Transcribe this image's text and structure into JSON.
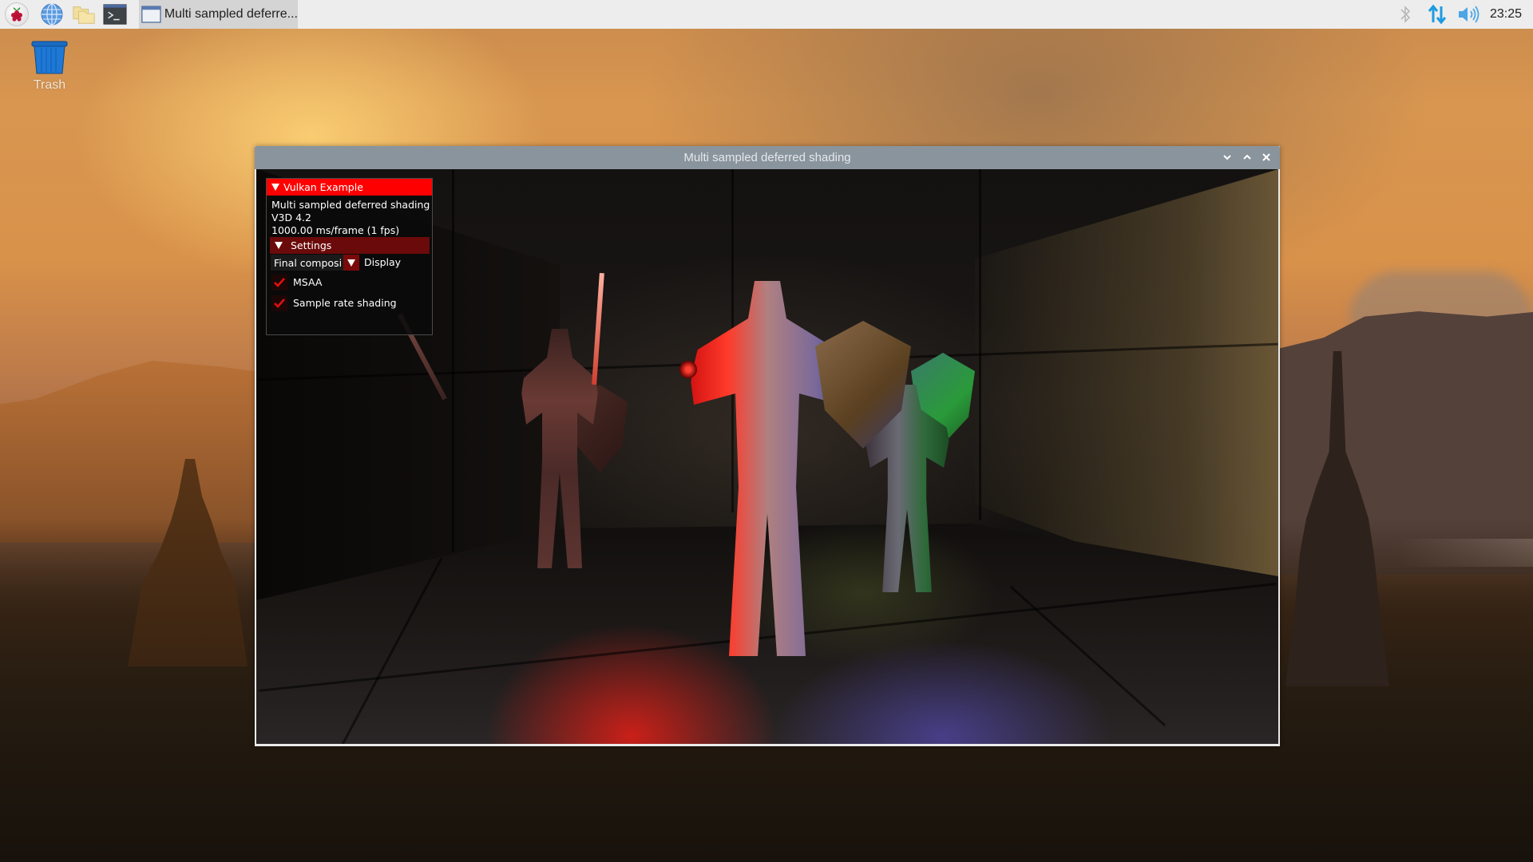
{
  "taskbar": {
    "launchers": [
      {
        "name": "raspberry-menu",
        "icon": "raspberry-pi-icon"
      },
      {
        "name": "web-browser",
        "icon": "globe-icon"
      },
      {
        "name": "file-manager",
        "icon": "folder-icon"
      },
      {
        "name": "terminal",
        "icon": "terminal-icon"
      }
    ],
    "task_button_label": "Multi sampled deferre...",
    "tray": {
      "bluetooth_icon": "bluetooth-icon",
      "network_icon": "network-updown-icon",
      "volume_icon": "volume-icon",
      "clock": "23:25"
    },
    "colors": {
      "background": "#ededed",
      "task_button": "#d4d4d4",
      "tray_accent": "#1e9ae0"
    }
  },
  "desktop": {
    "icons": [
      {
        "label": "Trash",
        "icon": "trash-icon"
      }
    ]
  },
  "window": {
    "title": "Multi sampled deferred shading",
    "controls": [
      "minimize",
      "maximize",
      "close"
    ],
    "titlebar_color": "#8a949c"
  },
  "imgui": {
    "header": "Vulkan Example",
    "lines": [
      "Multi sampled deferred shading",
      "V3D 4.2",
      "1000.00 ms/frame (1 fps)"
    ],
    "settings": {
      "header": "Settings",
      "combo_value": "Final composi",
      "combo_label": "Display",
      "checkboxes": [
        {
          "label": "MSAA",
          "checked": true
        },
        {
          "label": "Sample rate shading",
          "checked": true
        }
      ]
    },
    "colors": {
      "header_bg": "#ff0000",
      "settings_bg": "#6b0a0a",
      "check": "#e01010"
    }
  },
  "scene": {
    "description": "Three armored knights with swords and shields in a stone room lit by red, blue, green and yellow lights"
  }
}
